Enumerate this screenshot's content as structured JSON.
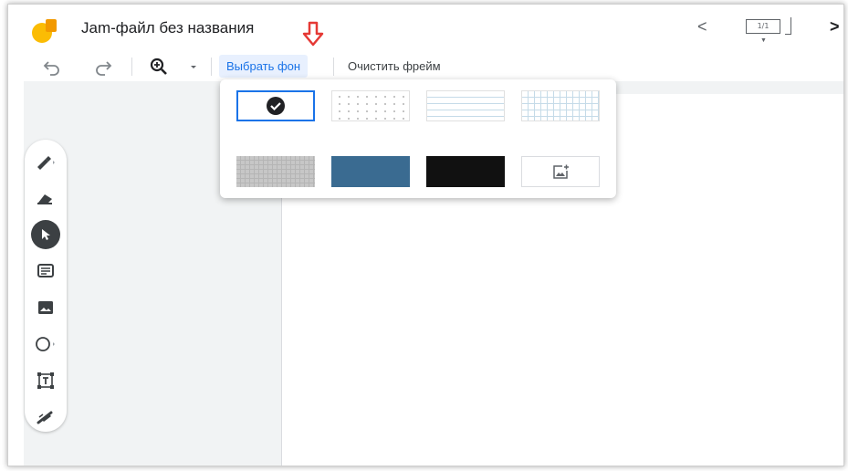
{
  "app": {
    "title": "Jam-файл без названия",
    "frame_counter": "1/1",
    "colors": {
      "accent": "#1a73e8",
      "logo_yellow": "#fbbc04",
      "logo_orange": "#f29900",
      "arrow_red": "#e53935"
    }
  },
  "nav": {
    "prev_icon": "chevron-left-icon",
    "next_icon": "chevron-right-icon"
  },
  "toolbar": {
    "undo_icon": "undo-icon",
    "redo_icon": "redo-icon",
    "zoom_icon": "zoom-in-icon",
    "set_background_label": "Выбрать фон",
    "clear_frame_label": "Очистить фрейм"
  },
  "tools": [
    {
      "name": "pen",
      "icon": "pen-icon"
    },
    {
      "name": "eraser",
      "icon": "eraser-icon"
    },
    {
      "name": "select",
      "icon": "cursor-icon",
      "active": true
    },
    {
      "name": "sticky-note",
      "icon": "sticky-note-icon"
    },
    {
      "name": "image",
      "icon": "image-icon"
    },
    {
      "name": "shape",
      "icon": "circle-icon"
    },
    {
      "name": "text-box",
      "icon": "text-box-icon"
    },
    {
      "name": "laser",
      "icon": "laser-icon"
    }
  ],
  "background_popup": {
    "options": [
      {
        "name": "blank",
        "selected": true
      },
      {
        "name": "dots"
      },
      {
        "name": "lines"
      },
      {
        "name": "squares"
      },
      {
        "name": "gray-grid",
        "color": "#c7c7c7"
      },
      {
        "name": "blue",
        "color": "#3a6b91"
      },
      {
        "name": "black",
        "color": "#111111"
      },
      {
        "name": "upload-image",
        "icon": "add-image-icon"
      }
    ]
  }
}
